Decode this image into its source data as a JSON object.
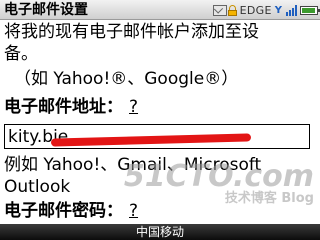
{
  "app": {
    "title": "电子邮件设置"
  },
  "status": {
    "network": "EDGE",
    "signal_glyph": "Y",
    "signal_bars": 4,
    "battery_level": 0.9,
    "battery_color": "#3c9a2e"
  },
  "intro": {
    "line1": "将我的现有电子邮件帐户添加至设备。",
    "line1_a": "将我的现有电子邮件帐户添加至设",
    "line1_b": "备。",
    "line2": "（如 Yahoo!®、Google®）"
  },
  "email": {
    "label": "电子邮件地址：",
    "help": "?",
    "value": "kity.bie",
    "example_line1": "例如 Yahoo!、Gmail、Microsoft",
    "example_line2": "Outlook",
    "redaction_color": "#e31515"
  },
  "password": {
    "label": "电子邮件密码：",
    "help": "?"
  },
  "carrier": {
    "name": "中国移动"
  },
  "watermark": {
    "top": "51CTO.com",
    "bottom": "技术博客 Blog"
  }
}
